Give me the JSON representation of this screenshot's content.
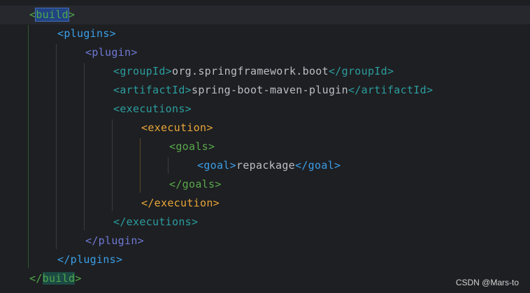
{
  "editor": {
    "language": "xml",
    "lines": [
      {
        "indent": 0,
        "open": "<",
        "tag": "build",
        "close": ">",
        "text": "",
        "endOpen": "",
        "endTag": "",
        "endClose": "",
        "color": "build"
      },
      {
        "indent": 1,
        "open": "<",
        "tag": "plugins",
        "close": ">",
        "color": "plugins"
      },
      {
        "indent": 2,
        "open": "<",
        "tag": "plugin",
        "close": ">",
        "color": "plugin"
      },
      {
        "indent": 3,
        "open": "<",
        "tag": "groupId",
        "close": ">",
        "text": "org.springframework.boot",
        "endTag": "groupId",
        "color": "teal"
      },
      {
        "indent": 3,
        "open": "<",
        "tag": "artifactId",
        "close": ">",
        "text": "spring-boot-maven-plugin",
        "endTag": "artifactId",
        "color": "teal"
      },
      {
        "indent": 3,
        "open": "<",
        "tag": "executions",
        "close": ">",
        "color": "teal"
      },
      {
        "indent": 4,
        "open": "<",
        "tag": "execution",
        "close": ">",
        "color": "exec"
      },
      {
        "indent": 5,
        "open": "<",
        "tag": "goals",
        "close": ">",
        "color": "goals"
      },
      {
        "indent": 6,
        "open": "<",
        "tag": "goal",
        "close": ">",
        "text": "repackage",
        "endTag": "goal",
        "color": "goal"
      },
      {
        "indent": 5,
        "open": "</",
        "tag": "goals",
        "close": ">",
        "color": "goals"
      },
      {
        "indent": 4,
        "open": "</",
        "tag": "execution",
        "close": ">",
        "color": "exec"
      },
      {
        "indent": 3,
        "open": "</",
        "tag": "executions",
        "close": ">",
        "color": "teal"
      },
      {
        "indent": 2,
        "open": "</",
        "tag": "plugin",
        "close": ">",
        "color": "plugin"
      },
      {
        "indent": 1,
        "open": "</",
        "tag": "plugins",
        "close": ">",
        "color": "plugins"
      },
      {
        "indent": 0,
        "open": "</",
        "tag": "build",
        "close": ">",
        "color": "build"
      }
    ]
  },
  "watermark": "CSDN @Mars-to",
  "colors": {
    "background": "#1e1f22",
    "current_line": "#26282e",
    "text": "#bcbec4",
    "build_tag": "#4ea84a",
    "plugins_tag": "#3aa0e8",
    "plugin_tag": "#6f79d6",
    "teal_tag": "#2b9ea0",
    "execution_tag": "#e9a739",
    "goals_tag": "#5aa84c",
    "goal_tag": "#3b9ee8"
  }
}
